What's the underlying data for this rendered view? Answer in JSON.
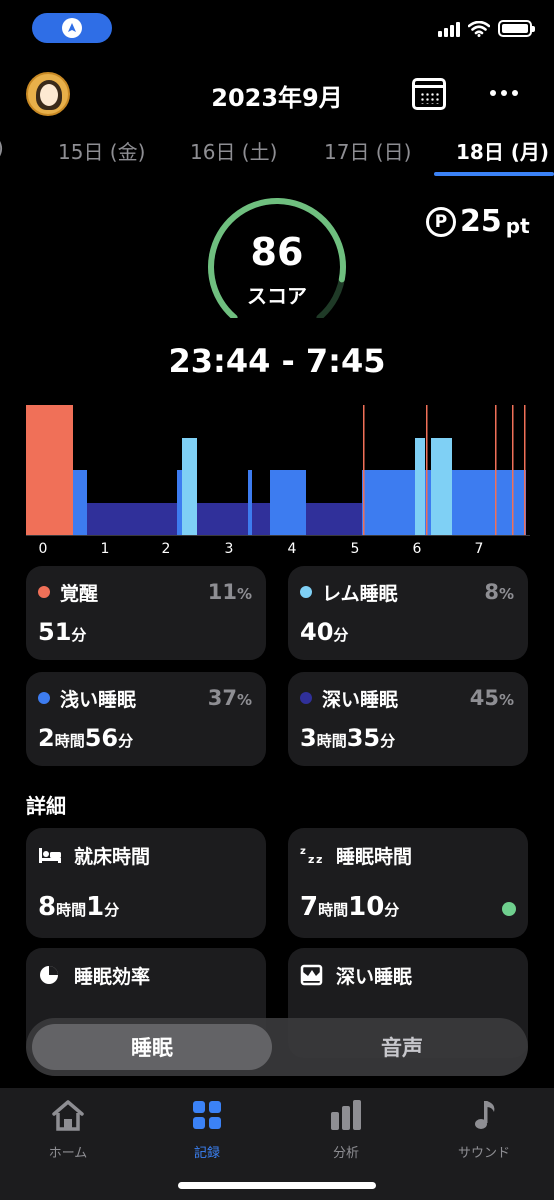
{
  "header": {
    "title": "2023年9月"
  },
  "date_tabs": [
    {
      "label": ")"
    },
    {
      "label": "15日 (金)"
    },
    {
      "label": "16日 (土)"
    },
    {
      "label": "17日 (日)"
    },
    {
      "label": "18日 (月)"
    }
  ],
  "score": {
    "value": "86",
    "label": "スコア",
    "fraction": 0.86,
    "ring_color": "#6fbf7f"
  },
  "points": {
    "icon": "P",
    "value": "25",
    "unit": "pt"
  },
  "time_range": "23:44 - 7:45",
  "colors": {
    "awake": "#f07058",
    "rem": "#7fd0f5",
    "light": "#3d7cf0",
    "deep": "#30309a"
  },
  "hypnogram": {
    "hour_labels": [
      "0",
      "1",
      "2",
      "3",
      "4",
      "5",
      "6",
      "7"
    ],
    "start_hour": 0,
    "end_hour": 7.9
  },
  "stages": [
    {
      "name": "覚醒",
      "pct": "11",
      "pct_unit": "%",
      "dur": [
        {
          "n": "51",
          "u": "分"
        }
      ],
      "color": "#f07058"
    },
    {
      "name": "レム睡眠",
      "pct": "8",
      "pct_unit": "%",
      "dur": [
        {
          "n": "40",
          "u": "分"
        }
      ],
      "color": "#7fd0f5"
    },
    {
      "name": "浅い睡眠",
      "pct": "37",
      "pct_unit": "%",
      "dur": [
        {
          "n": "2",
          "u": "時間"
        },
        {
          "n": "56",
          "u": "分"
        }
      ],
      "color": "#3d7cf0"
    },
    {
      "name": "深い睡眠",
      "pct": "45",
      "pct_unit": "%",
      "dur": [
        {
          "n": "3",
          "u": "時間"
        },
        {
          "n": "35",
          "u": "分"
        }
      ],
      "color": "#30309a"
    }
  ],
  "details": {
    "section_title": "詳細",
    "cards": [
      {
        "name": "就床時間",
        "icon": "bed-icon",
        "dur": [
          {
            "n": "8",
            "u": "時間"
          },
          {
            "n": "1",
            "u": "分"
          }
        ]
      },
      {
        "name": "睡眠時間",
        "icon": "zzz-icon",
        "dur": [
          {
            "n": "7",
            "u": "時間"
          },
          {
            "n": "10",
            "u": "分"
          }
        ],
        "status_color": "#6fcf8e"
      },
      {
        "name": "睡眠効率",
        "icon": "pie-chart-icon"
      },
      {
        "name": "深い睡眠",
        "icon": "crown-chart-icon"
      }
    ]
  },
  "segment": {
    "active": "睡眠",
    "inactive": "音声"
  },
  "tab_bar": [
    {
      "label": "ホーム",
      "icon": "home-icon"
    },
    {
      "label": "記録",
      "icon": "grid-icon"
    },
    {
      "label": "分析",
      "icon": "bar-chart-icon"
    },
    {
      "label": "サウンド",
      "icon": "music-note-icon"
    }
  ]
}
